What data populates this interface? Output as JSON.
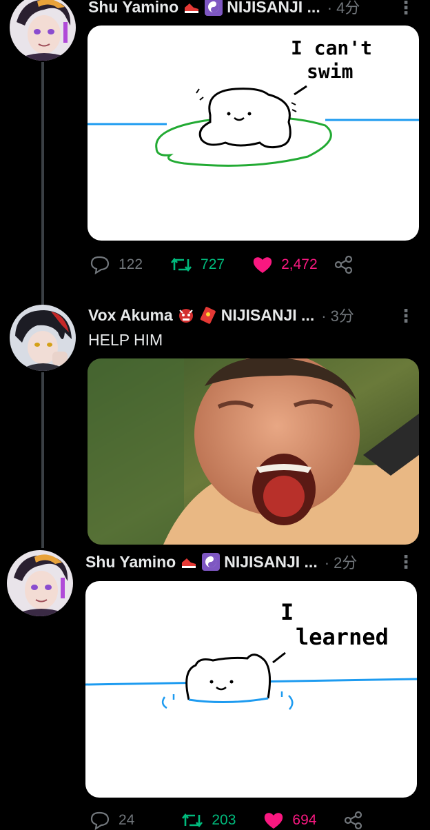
{
  "tweets": [
    {
      "author": "Shu Yamino",
      "org": "NIJISANJI ...",
      "time": "· 4分",
      "image_text": [
        "I can't",
        "swim"
      ],
      "replies": "122",
      "retweets": "727",
      "likes": "2,472"
    },
    {
      "author": "Vox Akuma",
      "org": "NIJISANJI ...",
      "time": "· 3分",
      "text": "HELP HIM"
    },
    {
      "author": "Shu Yamino",
      "org": "NIJISANJI ...",
      "time": "· 2分",
      "image_text": [
        "I",
        "learned"
      ],
      "replies": "24",
      "retweets": "203",
      "likes": "694"
    }
  ],
  "colors": {
    "background": "#000000",
    "retweet": "#00ba7c",
    "like": "#f91880",
    "muted": "#71767b",
    "water": "#1d9bf0",
    "lilypad": "#22aa33"
  },
  "icons": [
    "reply-icon",
    "retweet-icon",
    "heart-icon",
    "share-icon",
    "more-icon"
  ]
}
